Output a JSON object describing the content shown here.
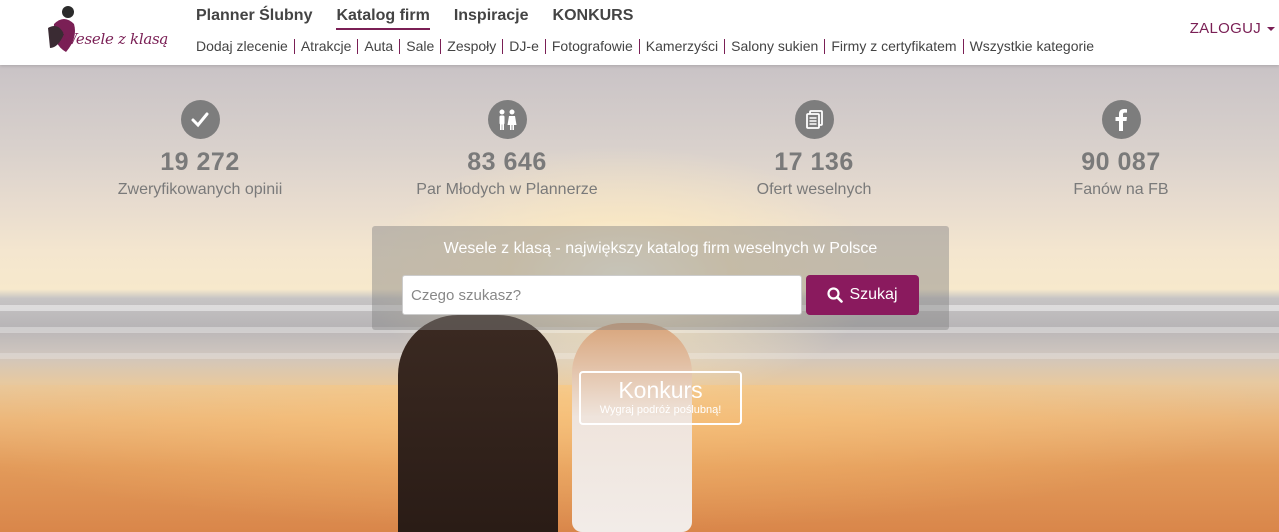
{
  "header": {
    "logo_text": "Wesele z klasą",
    "nav_main": [
      {
        "label": "Planner Ślubny",
        "active": false
      },
      {
        "label": "Katalog firm",
        "active": true
      },
      {
        "label": "Inspiracje",
        "active": false
      },
      {
        "label": "KONKURS",
        "active": false
      }
    ],
    "nav_sub": [
      "Dodaj zlecenie",
      "Atrakcje",
      "Auta",
      "Sale",
      "Zespoły",
      "DJ-e",
      "Fotografowie",
      "Kamerzyści",
      "Salony sukien",
      "Firmy z certyfikatem",
      "Wszystkie kategorie"
    ],
    "login_label": "ZALOGUJ"
  },
  "stats": [
    {
      "icon": "checkmark-icon",
      "value": "19 272",
      "label": "Zweryfikowanych opinii"
    },
    {
      "icon": "couple-icon",
      "value": "83 646",
      "label": "Par Młodych w Plannerze"
    },
    {
      "icon": "documents-icon",
      "value": "17 136",
      "label": "Ofert weselnych"
    },
    {
      "icon": "facebook-icon",
      "value": "90 087",
      "label": "Fanów na FB"
    }
  ],
  "search": {
    "title": "Wesele z klasą - największy katalog firm weselnych w Polsce",
    "placeholder": "Czego szukasz?",
    "value": "",
    "button_label": "Szukaj"
  },
  "contest": {
    "title": "Konkurs",
    "subtitle": "Wygraj podróż poślubną!"
  },
  "colors": {
    "brand": "#7a1f55",
    "button": "#8a1a5e",
    "stat_gray": "#7a7a7a"
  }
}
